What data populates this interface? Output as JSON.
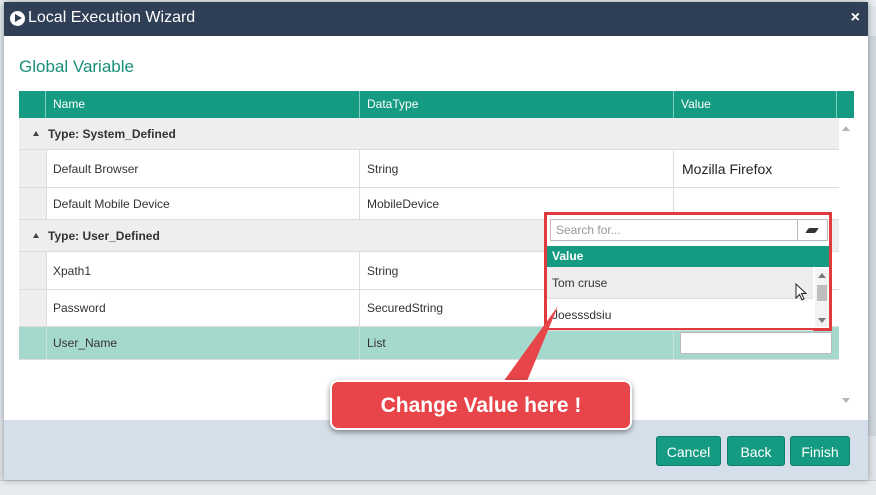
{
  "window": {
    "title": "Local Execution Wizard",
    "close_glyph": "×"
  },
  "section_title": "Global Variable",
  "grid": {
    "columns": [
      "Name",
      "DataType",
      "Value"
    ],
    "groups": [
      {
        "label": "Type: System_Defined",
        "rows": [
          {
            "name": "Default Browser",
            "datatype": "String",
            "value": "Mozilla Firefox"
          },
          {
            "name": "Default Mobile Device",
            "datatype": "MobileDevice",
            "value": ""
          }
        ]
      },
      {
        "label": "Type: User_Defined",
        "rows": [
          {
            "name": "Xpath1",
            "datatype": "String",
            "value": ""
          },
          {
            "name": "Password",
            "datatype": "SecuredString",
            "value": ""
          },
          {
            "name": "User_Name",
            "datatype": "List",
            "value": ""
          }
        ]
      }
    ]
  },
  "dropdown": {
    "search_placeholder": "Search for...",
    "header": "Value",
    "items": [
      "Tom cruse",
      "Joesssdsiu"
    ]
  },
  "callout": {
    "text": "Change Value here !"
  },
  "footer": {
    "cancel_label": "Cancel",
    "back_label": "Back",
    "finish_label": "Finish"
  },
  "colors": {
    "accent": "#169b83",
    "titlebar": "#2f3f55",
    "callout": "#e8454a",
    "selected_row": "#a6d9cd"
  }
}
